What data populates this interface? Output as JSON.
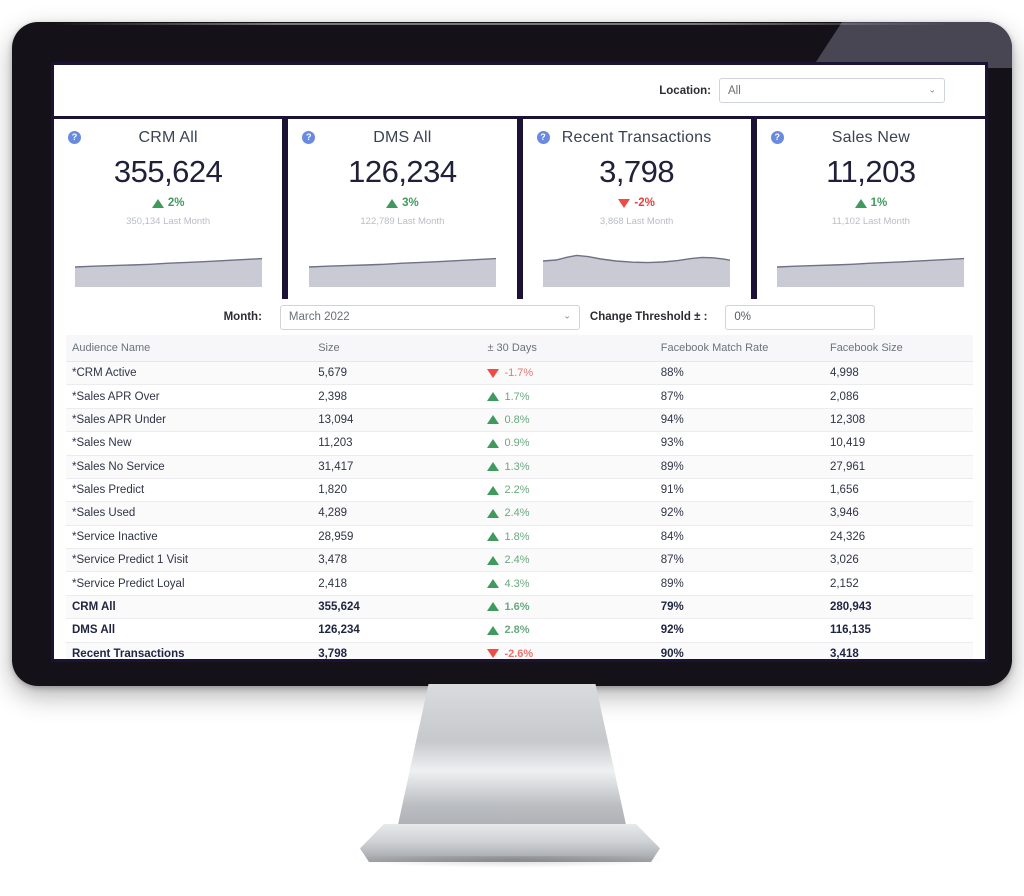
{
  "topbar": {
    "location_label": "Location:",
    "location_value": "All",
    "caret": "⌄"
  },
  "cards": [
    {
      "help": "?",
      "title": "CRM All",
      "value": "355,624",
      "delta": "2%",
      "direction": "up",
      "sub": "350,134 Last Month",
      "spark": "flat-rising"
    },
    {
      "help": "?",
      "title": "DMS All",
      "value": "126,234",
      "delta": "3%",
      "direction": "up",
      "sub": "122,789 Last Month",
      "spark": "flat-rising"
    },
    {
      "help": "?",
      "title": "Recent Transactions",
      "value": "3,798",
      "delta": "-2%",
      "direction": "down",
      "sub": "3,868 Last Month",
      "spark": "wavy"
    },
    {
      "help": "?",
      "title": "Sales New",
      "value": "11,203",
      "delta": "1%",
      "direction": "up",
      "sub": "11,102 Last Month",
      "spark": "flat-rising"
    }
  ],
  "filters": {
    "month_label": "Month:",
    "month_value": "March 2022",
    "threshold_label": "Change Threshold ± :",
    "threshold_value": "0%",
    "caret": "⌄"
  },
  "table": {
    "headers": [
      "Audience Name",
      "Size",
      "± 30 Days",
      "Facebook Match Rate",
      "Facebook Size"
    ],
    "rows": [
      {
        "name": "*CRM Active",
        "size": "5,679",
        "chg": "-1.7%",
        "dir": "down",
        "match": "88%",
        "fb": "4,998",
        "bold": false
      },
      {
        "name": "*Sales APR Over",
        "size": "2,398",
        "chg": "1.7%",
        "dir": "up",
        "match": "87%",
        "fb": "2,086",
        "bold": false
      },
      {
        "name": "*Sales APR Under",
        "size": "13,094",
        "chg": "0.8%",
        "dir": "up",
        "match": "94%",
        "fb": "12,308",
        "bold": false
      },
      {
        "name": "*Sales New",
        "size": "11,203",
        "chg": "0.9%",
        "dir": "up",
        "match": "93%",
        "fb": "10,419",
        "bold": false
      },
      {
        "name": "*Sales No Service",
        "size": "31,417",
        "chg": "1.3%",
        "dir": "up",
        "match": "89%",
        "fb": "27,961",
        "bold": false
      },
      {
        "name": "*Sales Predict",
        "size": "1,820",
        "chg": "2.2%",
        "dir": "up",
        "match": "91%",
        "fb": "1,656",
        "bold": false
      },
      {
        "name": "*Sales Used",
        "size": "4,289",
        "chg": "2.4%",
        "dir": "up",
        "match": "92%",
        "fb": "3,946",
        "bold": false
      },
      {
        "name": "*Service Inactive",
        "size": "28,959",
        "chg": "1.8%",
        "dir": "up",
        "match": "84%",
        "fb": "24,326",
        "bold": false
      },
      {
        "name": "*Service Predict 1 Visit",
        "size": "3,478",
        "chg": "2.4%",
        "dir": "up",
        "match": "87%",
        "fb": "3,026",
        "bold": false
      },
      {
        "name": "*Service Predict Loyal",
        "size": "2,418",
        "chg": "4.3%",
        "dir": "up",
        "match": "89%",
        "fb": "2,152",
        "bold": false
      },
      {
        "name": "CRM All",
        "size": "355,624",
        "chg": "1.6%",
        "dir": "up",
        "match": "79%",
        "fb": "280,943",
        "bold": true
      },
      {
        "name": "DMS All",
        "size": "126,234",
        "chg": "2.8%",
        "dir": "up",
        "match": "92%",
        "fb": "116,135",
        "bold": true
      },
      {
        "name": "Recent Transactions",
        "size": "3,798",
        "chg": "-2.6%",
        "dir": "down",
        "match": "90%",
        "fb": "3,418",
        "bold": true
      }
    ]
  },
  "colors": {
    "frame": "#141218",
    "screen_border": "#1b1236",
    "up": "#3f9a5e",
    "down": "#e8403a",
    "help_icon": "#6a8ae0",
    "spark_fill": "#c9cad4"
  }
}
